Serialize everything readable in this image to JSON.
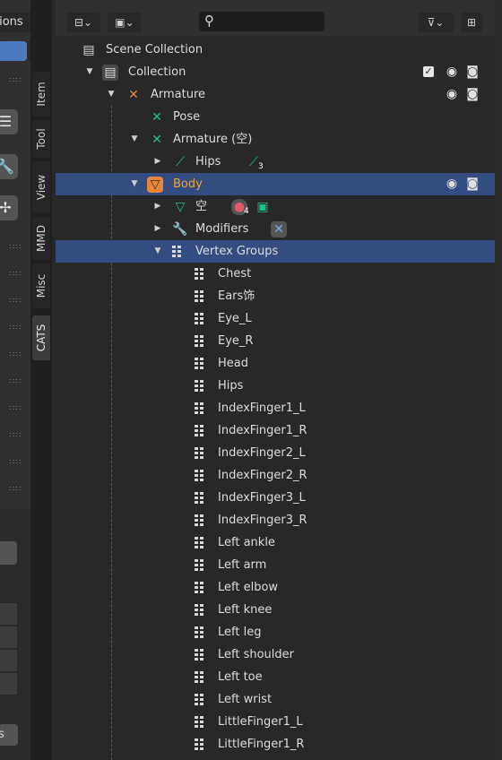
{
  "left_panel": {
    "header_dropdown": "tions",
    "lower_button": "s"
  },
  "tabs": [
    {
      "label": "Item"
    },
    {
      "label": "Tool"
    },
    {
      "label": "View"
    },
    {
      "label": "MMD"
    },
    {
      "label": "Misc"
    },
    {
      "label": "CATS"
    }
  ],
  "outliner": {
    "search_placeholder": "",
    "items": {
      "scene_collection": "Scene Collection",
      "collection": "Collection",
      "armature_obj": "Armature",
      "pose": "Pose",
      "armature_data": "Armature (空)",
      "hips": "Hips",
      "hips_badge": "3",
      "body": "Body",
      "mesh_data": "空",
      "material_badge": "4",
      "modifiers": "Modifiers",
      "vertex_groups": "Vertex Groups"
    },
    "vertex_groups": [
      "Chest",
      "Ears饰",
      "Eye_L",
      "Eye_R",
      "Head",
      "Hips",
      "IndexFinger1_L",
      "IndexFinger1_R",
      "IndexFinger2_L",
      "IndexFinger2_R",
      "IndexFinger3_L",
      "IndexFinger3_R",
      "Left ankle",
      "Left arm",
      "Left elbow",
      "Left knee",
      "Left leg",
      "Left shoulder",
      "Left toe",
      "Left wrist",
      "LittleFinger1_L",
      "LittleFinger1_R"
    ]
  },
  "colors": {
    "selection": "#334d80",
    "active_object_text": "#f0a336",
    "bone_green": "#1ec08c",
    "armature_orange": "#e8873a"
  }
}
